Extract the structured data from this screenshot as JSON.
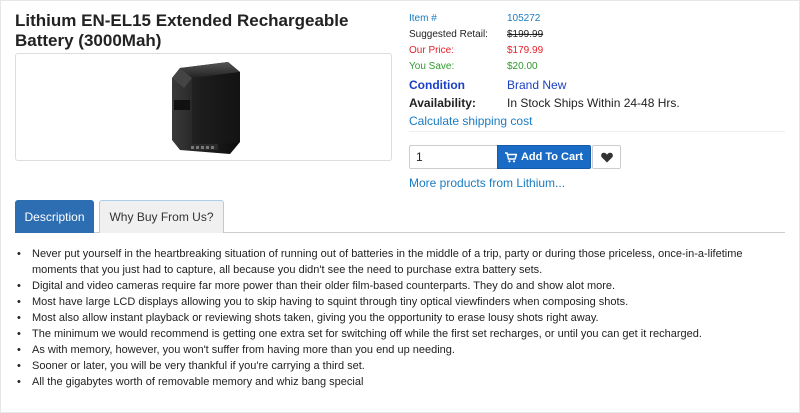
{
  "product": {
    "title": "Lithium EN-EL15 Extended Rechargeable Battery (3000Mah)"
  },
  "details": {
    "item_label": "Item #",
    "item_value": "105272",
    "suggested_label": "Suggested Retail:",
    "suggested_value": "$199.99",
    "price_label": "Our Price:",
    "price_value": "$179.99",
    "save_label": "You Save:",
    "save_value": "$20.00",
    "condition_label": "Condition",
    "condition_value": "Brand New",
    "availability_label": "Availability:",
    "availability_value": "In Stock Ships Within 24-48 Hrs.",
    "shipping_link": "Calculate shipping cost"
  },
  "cart": {
    "quantity": "1",
    "add_label": "Add To Cart",
    "more_link": "More products from Lithium..."
  },
  "tabs": {
    "description": "Description",
    "why_buy": "Why Buy From Us?"
  },
  "description": [
    "Never put yourself in the heartbreaking situation of running out of batteries in the middle of a trip, party or during those priceless, once-in-a-lifetime moments that you just had to capture, all because you didn't see the need to purchase extra battery sets.",
    "Digital and video cameras require far more power than their older film-based counterparts. They do and show alot more.",
    "Most have large LCD displays allowing you to skip having to squint through tiny optical viewfinders when composing shots.",
    "Most also allow instant playback or reviewing shots taken, giving you the opportunity to erase lousy shots right away.",
    "The minimum we would recommend is getting one extra set for switching off while the first set recharges, or until you can get it recharged.",
    "As with memory, however, you won't suffer from having more than you end up needing.",
    "Sooner or later, you will be very thankful if you're carrying a third set.",
    "All the gigabytes worth of removable memory and whiz bang special"
  ],
  "colors": {
    "link": "#1a7cc1",
    "price": "#e8202a",
    "save": "#2e9a2e",
    "button": "#1a6bc6",
    "tab_active": "#2d6eb3"
  },
  "icons": {
    "cart": "cart-icon",
    "wishlist": "heart-icon"
  }
}
